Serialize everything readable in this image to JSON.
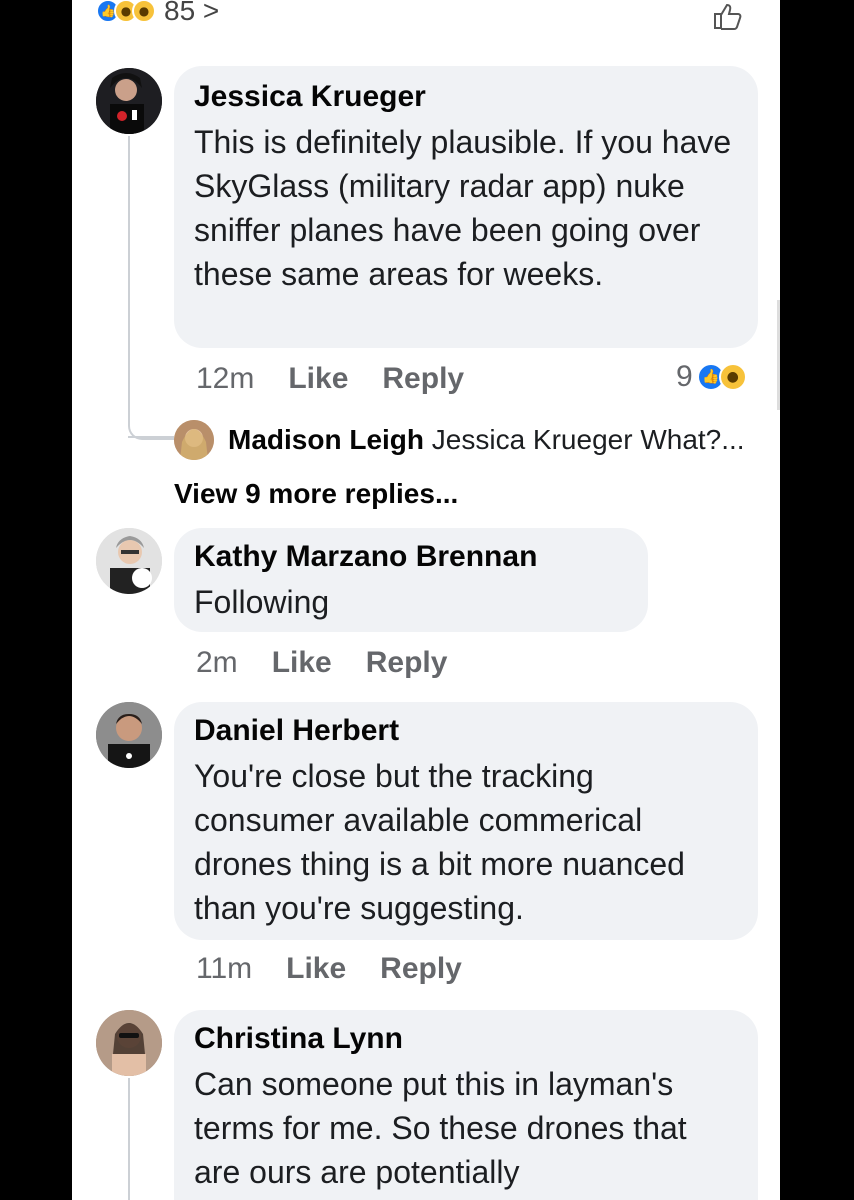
{
  "reactions_bar": {
    "count": "85 >",
    "icons": [
      "like-icon",
      "wow-icon",
      "haha-icon"
    ]
  },
  "comments": [
    {
      "name": "Jessica Krueger",
      "text": "This is definitely plausible. If you have SkyGlass (military radar app) nuke sniffer planes have been going over these same areas for weeks.",
      "time": "12m",
      "like": "Like",
      "reply": "Reply",
      "reaction_count": "9",
      "reactions": [
        "like-icon",
        "wow-icon"
      ],
      "replies_preview": {
        "name": "Madison Leigh",
        "text": "Jessica Krueger What?..."
      },
      "more_replies": "View 9 more replies..."
    },
    {
      "name": "Kathy Marzano Brennan",
      "text": "Following",
      "time": "2m",
      "like": "Like",
      "reply": "Reply"
    },
    {
      "name": "Daniel Herbert",
      "text": "You're close but the tracking consumer available commerical drones thing is a bit more nuanced than you're suggesting.",
      "time": "11m",
      "like": "Like",
      "reply": "Reply"
    },
    {
      "name": "Christina Lynn",
      "text": "Can someone put this in layman's terms for me. So these drones that are ours are potentially"
    }
  ],
  "colors": {
    "bubble": "#f0f2f5",
    "like_blue": "#1877f2",
    "wow_yellow": "#f7c23a",
    "meta_gray": "#65676b"
  }
}
